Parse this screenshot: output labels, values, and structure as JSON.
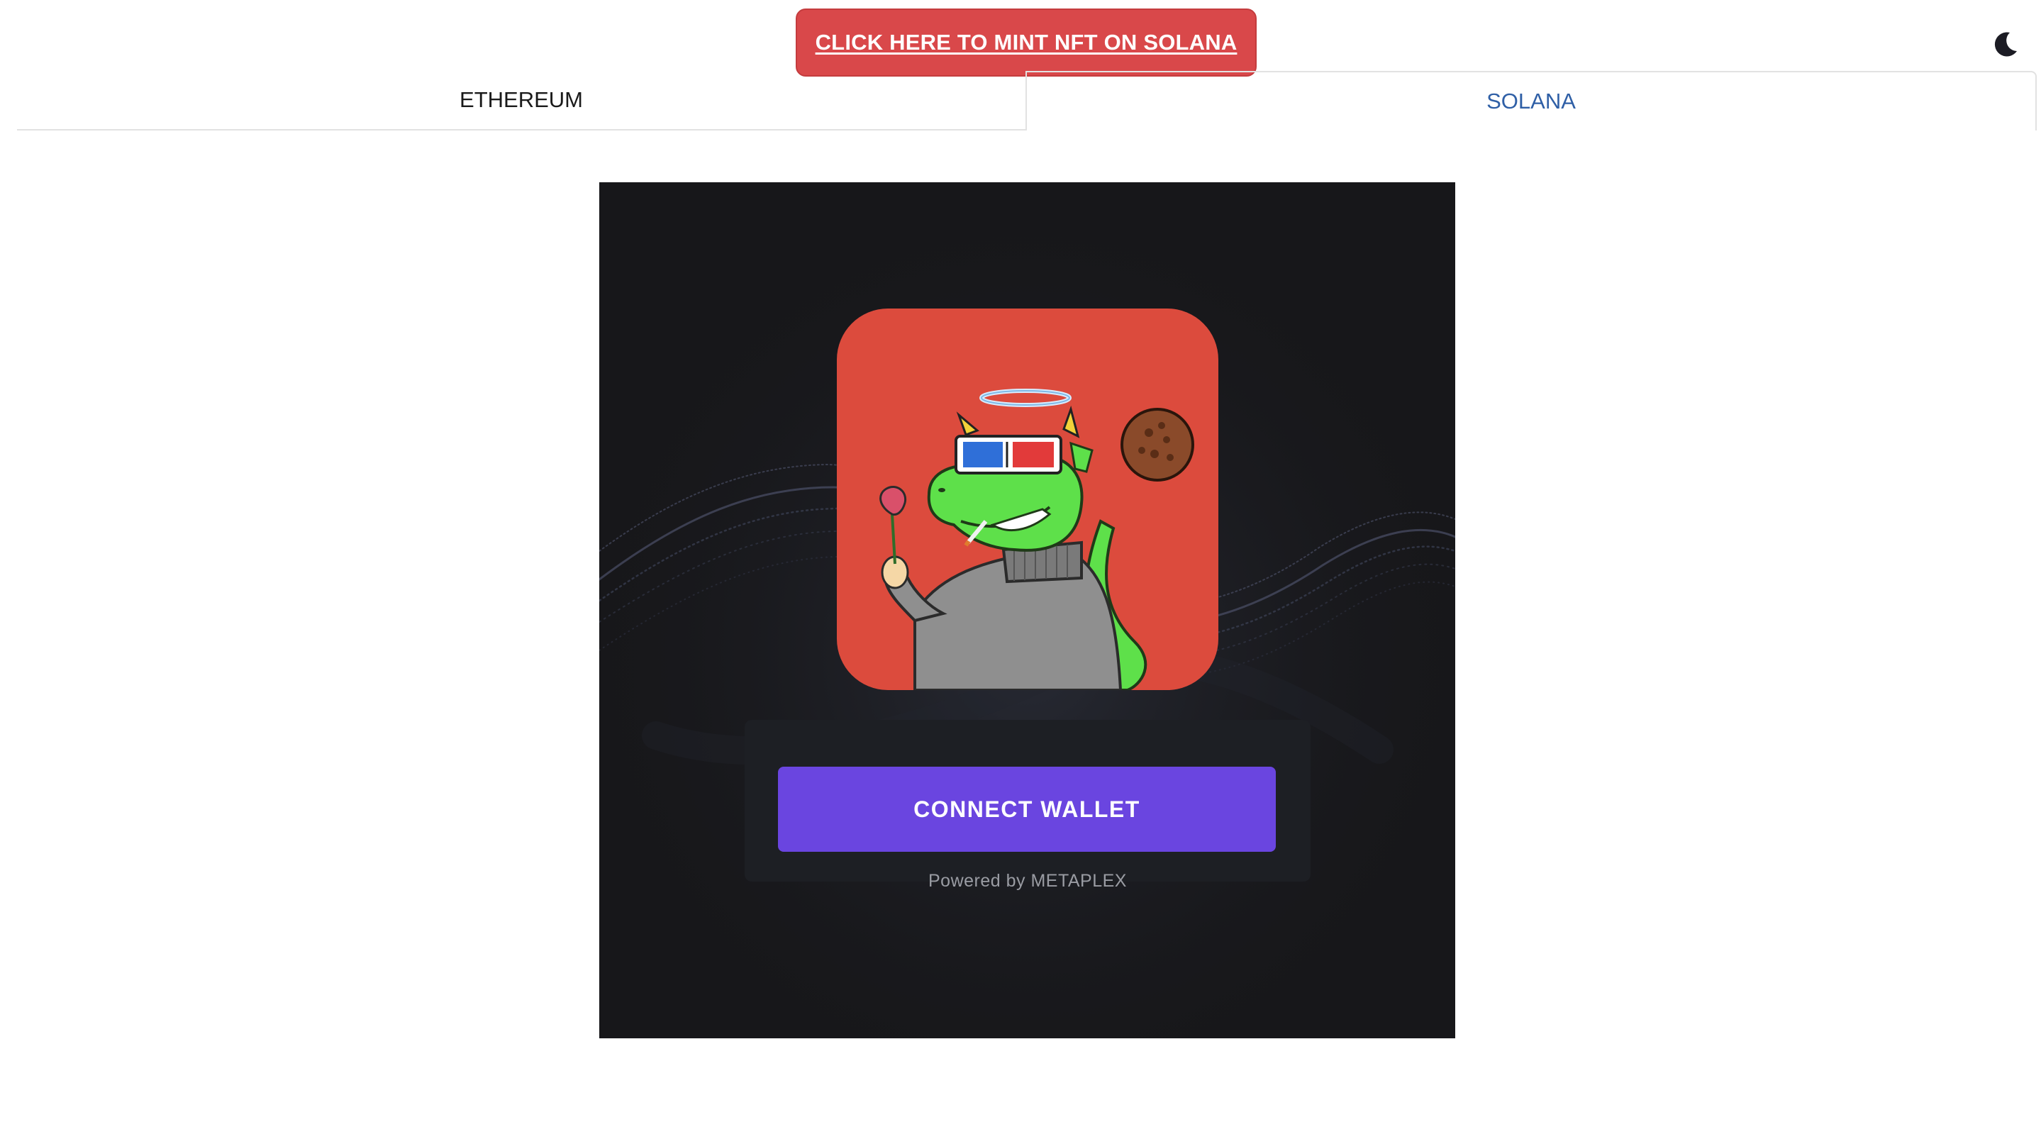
{
  "banner": {
    "label": "CLICK HERE TO MINT NFT ON SOLANA",
    "color": "#d9484a"
  },
  "theme_toggle": {
    "icon": "moon-icon"
  },
  "tabs": [
    {
      "label": "ETHEREUM",
      "active": false
    },
    {
      "label": "SOLANA",
      "active": true
    }
  ],
  "mint_panel": {
    "nft_image": "green-dragon-avatar",
    "nft_background_color": "#dc4b3d",
    "connect_button_label": "CONNECT WALLET",
    "connect_button_color": "#6a45e0",
    "powered_by": "Powered by METAPLEX"
  }
}
